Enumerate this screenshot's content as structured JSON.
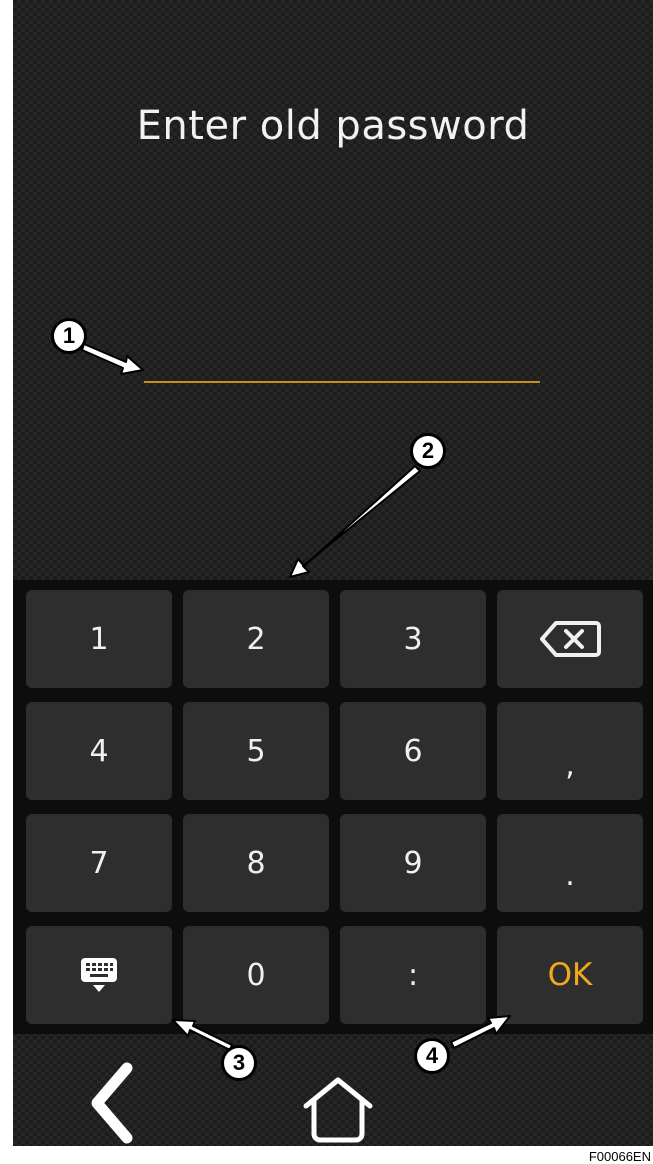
{
  "title": "Enter old password",
  "keypad": {
    "rows": [
      [
        "1",
        "2",
        "3",
        "backspace"
      ],
      [
        "4",
        "5",
        "6",
        ","
      ],
      [
        "7",
        "8",
        "9",
        "."
      ],
      [
        "keyboard",
        "0",
        ":",
        "OK"
      ]
    ],
    "ok_label": "OK"
  },
  "callouts": [
    "1",
    "2",
    "3",
    "4"
  ],
  "figure_code": "F00066EN",
  "colors": {
    "accent": "#f0a81c",
    "underline": "#c8901a",
    "key_bg": "#2e2e2e"
  },
  "icons": {
    "backspace": "backspace-icon",
    "keyboard": "keyboard-toggle-icon",
    "back": "back-icon",
    "home": "home-icon"
  }
}
